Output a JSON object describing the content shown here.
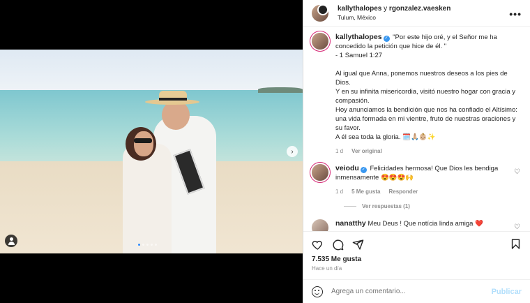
{
  "header": {
    "user1": "kallythalopes",
    "joiner": " y ",
    "user2": "rgonzalez.vaesken",
    "location": "Tulum, México",
    "more_icon": "more-horizontal-icon"
  },
  "caption": {
    "user": "kallythalopes",
    "lines": [
      "\"Por este hijo oré, y el Señor me ha concedido la petición que hice de él. \"",
      "- 1 Samuel 1:27",
      "",
      "Al igual que Anna, ponemos nuestros deseos a los pies de Dios.",
      "Y en su infinita misericordia, visitó nuestro hogar con gracia y compasión.",
      "Hoy anunciamos la bendición que nos ha confiado el Altísimo: una vida formada en mi vientre, fruto de nuestras oraciones y su favor.",
      "A él sea toda la gloria. 🗓️🙏🏼👶🏼✨"
    ],
    "time": "1 d",
    "see_translation": "Ver original"
  },
  "comments": [
    {
      "user": "veiodu",
      "text": "Felicidades hermosa! Que Dios les bendiga inmensamente 😍😍😍🙌",
      "time": "1 d",
      "likes": "5 Me gusta",
      "reply": "Responder",
      "view_replies": "Ver respuestas (1)"
    },
    {
      "user": "nanatthy",
      "text": "Meu Deus ! Que notícia linda amiga ❤️"
    }
  ],
  "actions": {
    "likes": "7.535 Me gusta",
    "posted": "Hace un día"
  },
  "composer": {
    "placeholder": "Agrega un comentario...",
    "post_label": "Publicar"
  },
  "colors": {
    "accent": "#3897f0",
    "post_disabled": "#b2dffc",
    "muted": "#8e8e8e"
  }
}
